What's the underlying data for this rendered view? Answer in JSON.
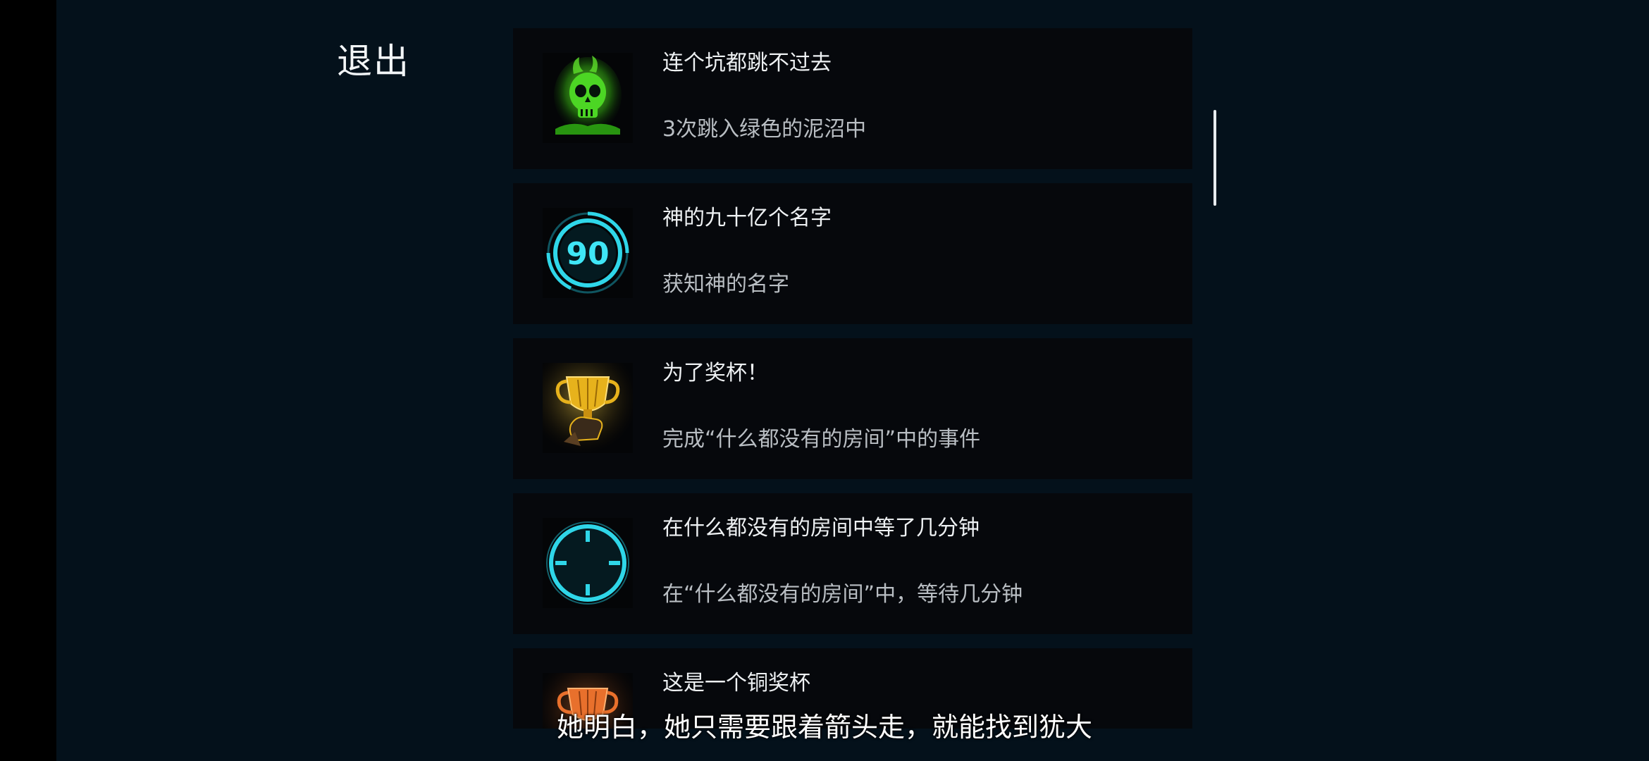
{
  "header": {
    "exit_label": "退出"
  },
  "achievements": [
    {
      "title": "连个坑都跳不过去",
      "description": "3次跳入绿色的泥沼中",
      "icon": "green-skull-icon"
    },
    {
      "title": "神的九十亿个名字",
      "description": "获知神的名字",
      "icon": "ring-90-icon",
      "icon_text": "90"
    },
    {
      "title": "为了奖杯！",
      "description": "完成“什么都没有的房间”中的事件",
      "icon": "gold-trophy-icon"
    },
    {
      "title": "在什么都没有的房间中等了几分钟",
      "description": "在“什么都没有的房间”中，等待几分钟",
      "icon": "clock-icon"
    },
    {
      "title": "这是一个铜奖杯",
      "description": "",
      "icon": "bronze-trophy-icon"
    }
  ],
  "subtitle": "她明白，她只需要跟着箭头走，就能找到犹大",
  "colors": {
    "background": "#04111b",
    "card": "#06080c",
    "title_text": "#eef1f3",
    "desc_text": "#b9bec3",
    "cyan_accent": "#2fd6e8",
    "green_accent": "#4cd624",
    "gold_accent": "#e7b21c",
    "bronze_accent": "#e8702c"
  }
}
